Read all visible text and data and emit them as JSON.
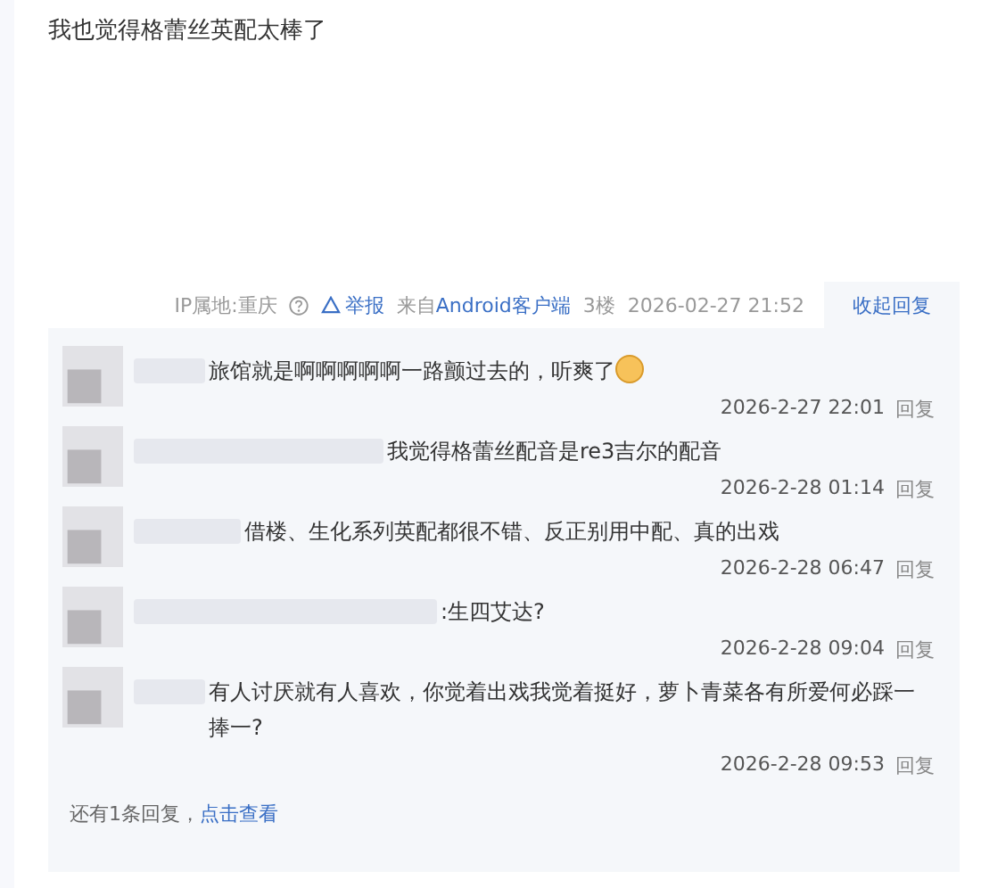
{
  "post": {
    "text": "我也觉得格蕾丝英配太棒了"
  },
  "meta": {
    "ip_location": "IP属地:重庆",
    "report": "举报",
    "source_prefix": "来自",
    "source_link": "Android客户端",
    "floor": "3楼",
    "time": "2026-02-27 21:52",
    "collapse_button": "收起回复"
  },
  "replies": [
    {
      "text": "旅馆就是啊啊啊啊啊一路颤过去的，听爽了",
      "emoji": true,
      "time": "2026-2-27 22:01",
      "reply": "回复"
    },
    {
      "text": "我觉得格蕾丝配音是re3吉尔的配音",
      "emoji": false,
      "time": "2026-2-28 01:14",
      "reply": "回复"
    },
    {
      "text": "借楼、生化系列英配都很不错、反正别用中配、真的出戏",
      "emoji": false,
      "time": "2026-2-28 06:47",
      "reply": "回复"
    },
    {
      "text": ":生四艾达?",
      "emoji": false,
      "time": "2026-2-28 09:04",
      "reply": "回复"
    },
    {
      "text": "有人讨厌就有人喜欢，你觉着出戏我觉着挺好，萝卜青菜各有所爱何必踩一捧一?",
      "emoji": false,
      "time": "2026-2-28 09:53",
      "reply": "回复"
    }
  ],
  "more": {
    "text": "还有1条回复，",
    "link": "点击查看"
  }
}
